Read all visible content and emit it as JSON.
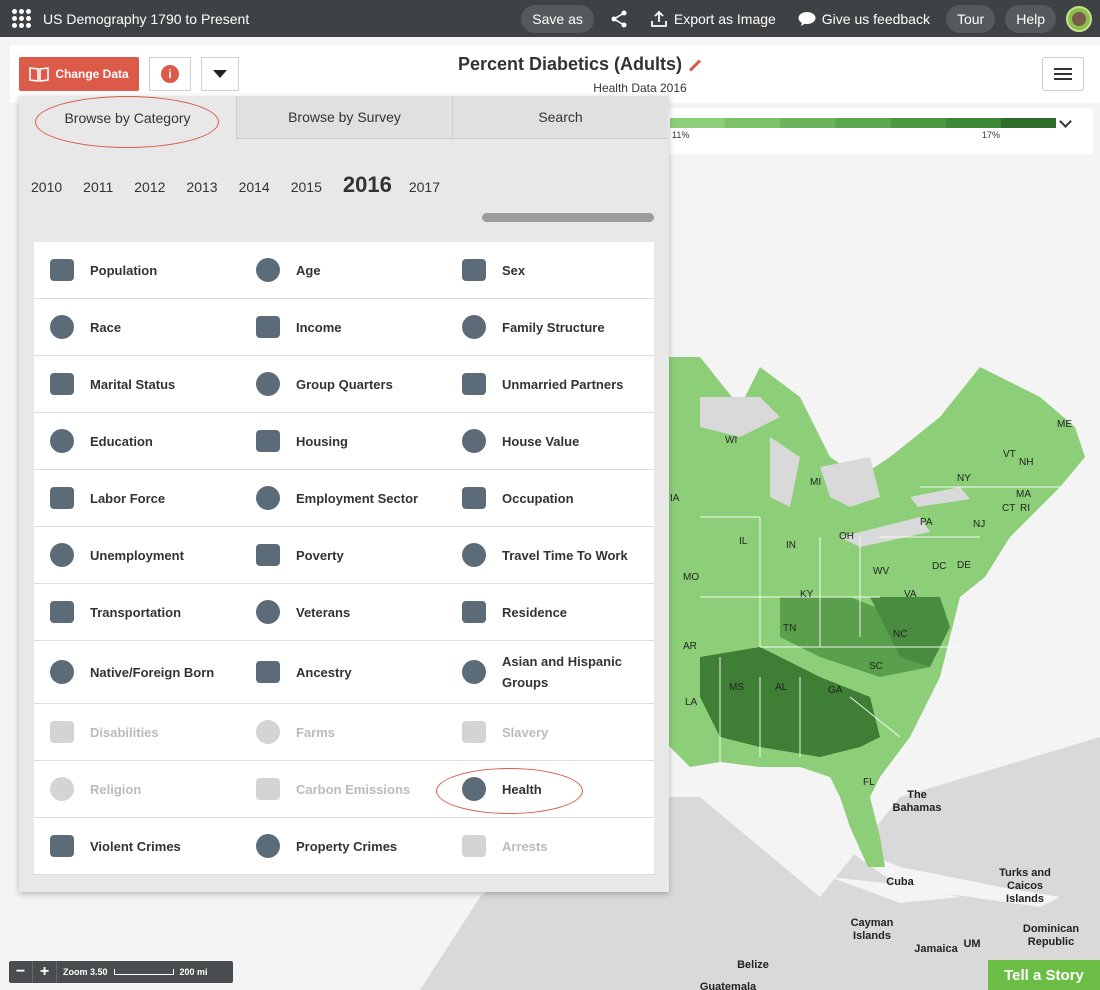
{
  "app": {
    "title": "US Demography 1790 to Present"
  },
  "topbar": {
    "save_as": "Save as",
    "export": "Export as Image",
    "feedback": "Give us feedback",
    "tour": "Tour",
    "help": "Help"
  },
  "header": {
    "change_data": "Change Data",
    "info": "i",
    "map_title": "Percent Diabetics (Adults)",
    "map_subtitle": "Health Data 2016"
  },
  "legend": {
    "labels": [
      "11%",
      "17%"
    ]
  },
  "panel": {
    "tabs": [
      "Browse by Category",
      "Browse by Survey",
      "Search"
    ],
    "active_tab": "Browse by Category",
    "years": [
      "2010",
      "2011",
      "2012",
      "2013",
      "2014",
      "2015",
      "2016",
      "2017"
    ],
    "selected_year": "2016",
    "categories": [
      [
        "Population",
        "Age",
        "Sex"
      ],
      [
        "Race",
        "Income",
        "Family Structure"
      ],
      [
        "Marital Status",
        "Group Quarters",
        "Unmarried Partners"
      ],
      [
        "Education",
        "Housing",
        "House Value"
      ],
      [
        "Labor Force",
        "Employment Sector",
        "Occupation"
      ],
      [
        "Unemployment",
        "Poverty",
        "Travel Time To Work"
      ],
      [
        "Transportation",
        "Veterans",
        "Residence"
      ],
      [
        "Native/Foreign Born",
        "Ancestry",
        "Asian and Hispanic Groups"
      ],
      [
        "Disabilities",
        "Farms",
        "Slavery"
      ],
      [
        "Religion",
        "Carbon Emissions",
        "Health"
      ],
      [
        "Violent Crimes",
        "Property Crimes",
        "Arrests"
      ]
    ],
    "disabled": [
      "Disabilities",
      "Farms",
      "Slavery",
      "Religion",
      "Carbon Emissions",
      "Arrests"
    ],
    "icons": [
      [
        "people-icon",
        "age-icon",
        "sex-icon"
      ],
      [
        "race-icon",
        "dollar-icon",
        "family-icon"
      ],
      [
        "rings-icon",
        "building-icon",
        "couple-icon"
      ],
      [
        "book-icon",
        "houses-icon",
        "house-value-icon"
      ],
      [
        "tools-icon",
        "briefcase-icon",
        "worker-icon"
      ],
      [
        "unemployment-icon",
        "money-bag-icon",
        "clock-icon"
      ],
      [
        "car-icon",
        "soldier-icon",
        "home-door-icon"
      ],
      [
        "globe-icon",
        "plant-icon",
        "persons-icon"
      ],
      [
        "wheelchair-icon",
        "sprout-icon",
        "ball-chain-icon"
      ],
      [
        "church-icon",
        "co2-icon",
        "heart-pulse-icon"
      ],
      [
        "gun-icon",
        "thief-icon",
        "handcuffs-icon"
      ]
    ]
  },
  "map": {
    "state_labels": [
      "WI",
      "MI",
      "ME",
      "VT",
      "NH",
      "NY",
      "MA",
      "CT",
      "RI",
      "PA",
      "NJ",
      "IA",
      "IL",
      "IN",
      "OH",
      "DE",
      "DC",
      "MO",
      "WV",
      "KY",
      "VA",
      "TN",
      "NC",
      "AR",
      "SC",
      "MS",
      "AL",
      "GA",
      "LA",
      "FL"
    ],
    "places": [
      "The Bahamas",
      "Cuba",
      "Turks and Caicos Islands",
      "Cayman Islands",
      "Jamaica",
      "UM",
      "Dominican Republic",
      "Belize",
      "Guatemala"
    ]
  },
  "footer": {
    "zoom_label": "Zoom 3.50",
    "scale": "200 mi",
    "tell_story": "Tell a Story"
  },
  "colors": {
    "accent": "#dc5a48",
    "map_green_light": "#8ccf78",
    "map_green_dark": "#2f6b2a",
    "story_green": "#6cbd45"
  }
}
